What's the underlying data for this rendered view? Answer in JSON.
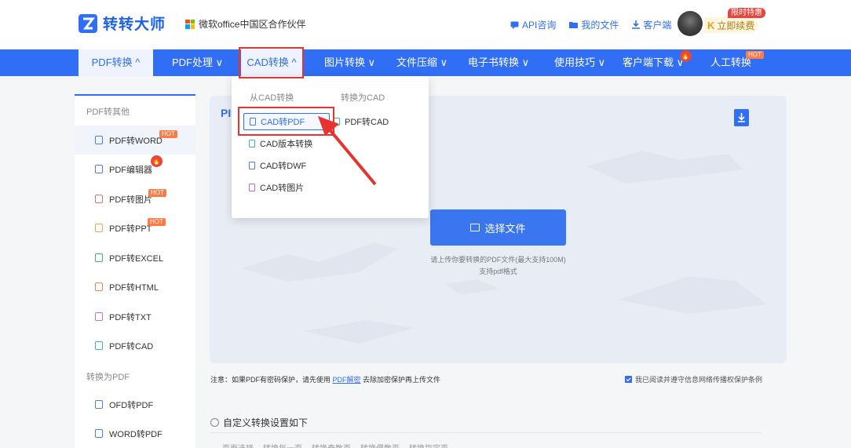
{
  "header": {
    "brand": "转转大师",
    "partner": "微软office中国区合作伙伴",
    "links": [
      "API咨询",
      "我的文件",
      "客户端"
    ],
    "special_tag": "限时特惠",
    "renew": "立即续费",
    "vip_mark": "K",
    "colors": {
      "brand": "#2f6ef5",
      "accent": "#e8322d"
    }
  },
  "nav": {
    "items": [
      "PDF转换 ^",
      "PDF处理 ∨",
      "CAD转换 ^",
      "图片转换 ∨",
      "文件压缩 ∨",
      "电子书转换 ∨",
      "使用技巧 ∨",
      "客户端下载 ∨",
      "人工转换"
    ],
    "hot": "HOT",
    "fire": "🔥"
  },
  "dropdown": {
    "from_cad_header": "从CAD转换",
    "to_cad_header": "转换为CAD",
    "from_cad": [
      "CAD转PDF",
      "CAD版本转换",
      "CAD转DWF",
      "CAD转图片"
    ],
    "to_cad": [
      "PDF转CAD"
    ]
  },
  "sidebar": {
    "section1": "PDF转其他",
    "items1": [
      "PDF转WORD",
      "PDF编辑器",
      "PDF转图片",
      "PDF转PPT",
      "PDF转EXCEL",
      "PDF转HTML",
      "PDF转TXT",
      "PDF转CAD"
    ],
    "section2": "转换为PDF",
    "items2": [
      "OFD转PDF",
      "WORD转PDF"
    ],
    "hot": "HOT"
  },
  "upload": {
    "title_partial": "PI",
    "button": "选择文件",
    "hint1": "请上传你要转换的PDF文件(最大支持100M)",
    "hint2": "支持pdf格式"
  },
  "note": {
    "prefix": "注意：如果PDF有密码保护，请先使用 ",
    "link": "PDF解密",
    "suffix": " 去除加密保护再上传文件"
  },
  "agree": "我已阅读并遵守信息网络传播权保护条例",
  "custom": {
    "title": "自定义转换设置如下",
    "options": [
      "页面选择",
      "转换每一页",
      "转换奇数页",
      "转换偶数页",
      "转换指定页"
    ]
  }
}
